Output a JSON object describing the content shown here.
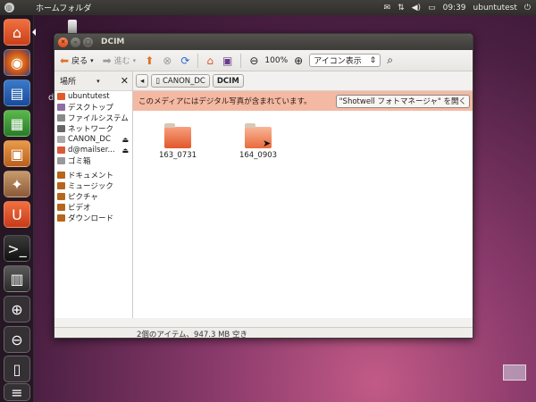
{
  "top_panel": {
    "title": "ホームフォルダ",
    "time": "09:39",
    "user": "ubuntutest",
    "indicator_icons": [
      "mail-icon",
      "network-icon",
      "volume-icon",
      "keyboard-icon"
    ]
  },
  "launcher": {
    "items": [
      "home-folder",
      "firefox",
      "libreoffice-writer",
      "libreoffice-calc",
      "libreoffice-impress",
      "software-center",
      "ubuntu-one",
      "terminal",
      "workspace-switcher",
      "zoom-in",
      "zoom-out",
      "usb-drive",
      "trash"
    ]
  },
  "window": {
    "title": "DCIM",
    "toolbar": {
      "back": "戻る",
      "forward": "進む",
      "zoom_level": "100%",
      "view_mode": "アイコン表示"
    },
    "sidebar": {
      "header": "場所",
      "items": [
        {
          "label": "ubuntutest",
          "icon": "home-icon",
          "color": "#e05a2a"
        },
        {
          "label": "デスクトップ",
          "icon": "desktop-icon",
          "color": "#8a6fa0"
        },
        {
          "label": "ファイルシステム",
          "icon": "drive-icon",
          "color": "#888888"
        },
        {
          "label": "ネットワーク",
          "icon": "network-icon",
          "color": "#666666"
        },
        {
          "label": "CANON_DC",
          "icon": "usb-icon",
          "color": "#aaaaaa",
          "eject": true
        },
        {
          "label": "d@mailser...",
          "icon": "mail-icon",
          "color": "#d85a3a",
          "eject": true
        },
        {
          "label": "ゴミ箱",
          "icon": "trash-icon",
          "color": "#999999"
        }
      ],
      "bookmarks": [
        {
          "label": "ドキュメント",
          "icon": "folder-icon",
          "color": "#b5651d"
        },
        {
          "label": "ミュージック",
          "icon": "music-icon",
          "color": "#b5651d"
        },
        {
          "label": "ピクチャ",
          "icon": "picture-icon",
          "color": "#b5651d"
        },
        {
          "label": "ビデオ",
          "icon": "video-icon",
          "color": "#b5651d"
        },
        {
          "label": "ダウンロード",
          "icon": "download-icon",
          "color": "#b5651d"
        }
      ]
    },
    "pathbar": [
      "CANON_DC",
      "DCIM"
    ],
    "info_bar": {
      "message": "このメディアにはデジタル写真が含まれています。",
      "button": "\"Shotwell フォトマネージャ\" を開く"
    },
    "folders": [
      {
        "name": "163_0731"
      },
      {
        "name": "164_0903"
      }
    ],
    "status": "2個のアイテム、947.3 MB 空き"
  }
}
